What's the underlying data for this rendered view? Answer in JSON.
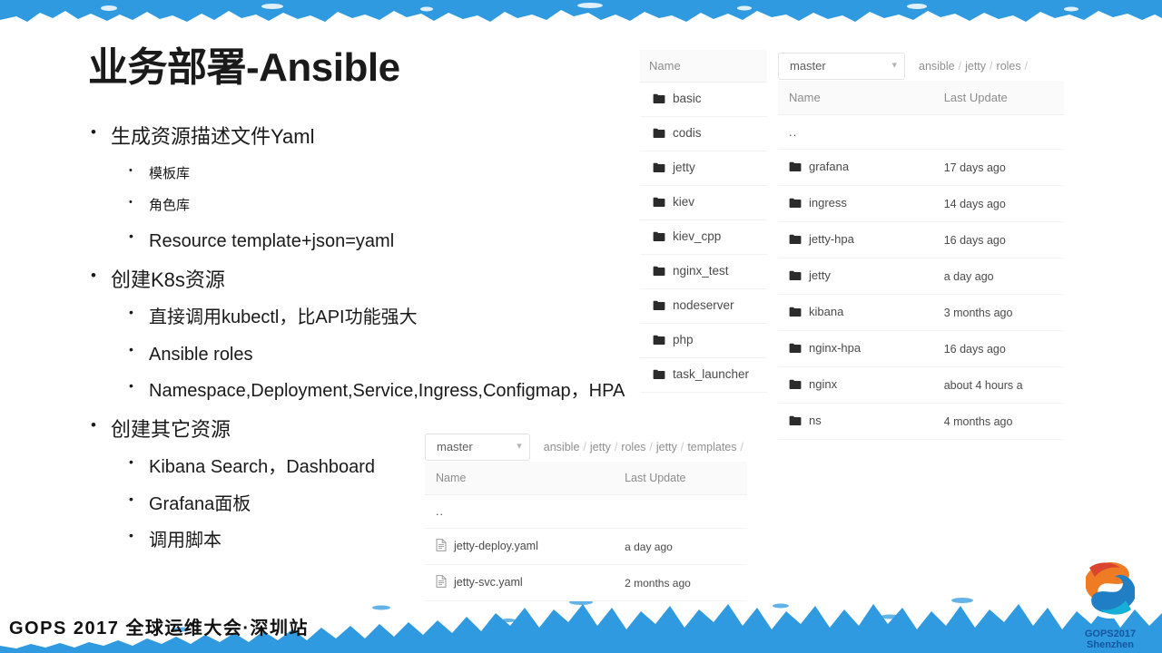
{
  "slide": {
    "title": "业务部署-Ansible",
    "footer": "GOPS 2017 全球运维大会·深圳站"
  },
  "logo": {
    "line1": "GOPS2017",
    "line2": "Shenzhen",
    "color_orange": "#ef7b25",
    "color_blue": "#1f7ec4"
  },
  "colors": {
    "banner_blue": "#2f9ae0",
    "text_dark": "#1a1a1a",
    "panel_header_bg": "#fafafa",
    "muted_text": "#8c8c8c"
  },
  "outline": [
    {
      "text": "生成资源描述文件Yaml",
      "children": [
        {
          "text": "模板库",
          "small": true
        },
        {
          "text": "角色库",
          "small": true
        },
        {
          "text": "Resource template+json=yaml",
          "small": false
        }
      ]
    },
    {
      "text": "创建K8s资源",
      "children": [
        {
          "text": "直接调用kubectl，比API功能强大",
          "small": false
        },
        {
          "text": "Ansible roles",
          "small": false
        },
        {
          "text": "Namespace,Deployment,Service,Ingress,Configmap，HPA",
          "small": false
        }
      ]
    },
    {
      "text": "创建其它资源",
      "children": [
        {
          "text": "Kibana Search，Dashboard",
          "small": false
        },
        {
          "text": "Grafana面板",
          "small": false
        },
        {
          "text": "调用脚本",
          "small": false
        }
      ]
    }
  ],
  "panel_left": {
    "column_name": "Name",
    "rows": [
      {
        "icon": "folder-icon",
        "name": "basic"
      },
      {
        "icon": "folder-icon",
        "name": "codis"
      },
      {
        "icon": "folder-icon",
        "name": "jetty"
      },
      {
        "icon": "folder-icon",
        "name": "kiev"
      },
      {
        "icon": "folder-icon",
        "name": "kiev_cpp"
      },
      {
        "icon": "folder-icon",
        "name": "nginx_test"
      },
      {
        "icon": "folder-icon",
        "name": "nodeserver"
      },
      {
        "icon": "folder-icon",
        "name": "php"
      },
      {
        "icon": "folder-icon",
        "name": "task_launcher"
      }
    ]
  },
  "panel_right": {
    "branch": "master",
    "breadcrumb": [
      "ansible",
      "jetty",
      "roles"
    ],
    "column_name": "Name",
    "column_update": "Last Update",
    "parent_row": "..",
    "rows": [
      {
        "icon": "folder-icon",
        "name": "grafana",
        "update": "17 days ago"
      },
      {
        "icon": "folder-icon",
        "name": "ingress",
        "update": "14 days ago"
      },
      {
        "icon": "folder-icon",
        "name": "jetty-hpa",
        "update": "16 days ago"
      },
      {
        "icon": "folder-icon",
        "name": "jetty",
        "update": "a day ago"
      },
      {
        "icon": "folder-icon",
        "name": "kibana",
        "update": "3 months ago"
      },
      {
        "icon": "folder-icon",
        "name": "nginx-hpa",
        "update": "16 days ago"
      },
      {
        "icon": "folder-icon",
        "name": "nginx",
        "update": "about 4 hours a"
      },
      {
        "icon": "folder-icon",
        "name": "ns",
        "update": "4 months ago"
      }
    ]
  },
  "panel_bottom": {
    "branch": "master",
    "breadcrumb": [
      "ansible",
      "jetty",
      "roles",
      "jetty",
      "templates"
    ],
    "column_name": "Name",
    "column_update": "Last Update",
    "parent_row": "..",
    "rows": [
      {
        "icon": "file-icon",
        "name": "jetty-deploy.yaml",
        "update": "a day ago"
      },
      {
        "icon": "file-icon",
        "name": "jetty-svc.yaml",
        "update": "2 months ago"
      }
    ]
  }
}
